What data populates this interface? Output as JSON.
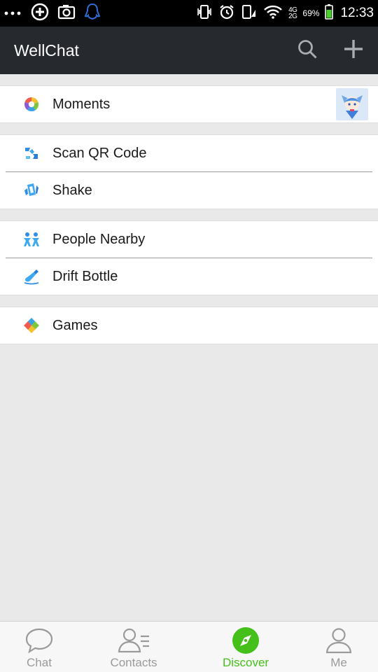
{
  "status_bar": {
    "network": "4G\n2G",
    "battery_percent": "69%",
    "time": "12:33"
  },
  "header": {
    "title": "WellChat"
  },
  "groups": [
    {
      "items": [
        {
          "label": "Moments",
          "icon": "moments-icon"
        }
      ]
    },
    {
      "items": [
        {
          "label": "Scan QR Code",
          "icon": "scan-qr-icon"
        },
        {
          "label": "Shake",
          "icon": "shake-icon"
        }
      ]
    },
    {
      "items": [
        {
          "label": "People Nearby",
          "icon": "people-nearby-icon"
        },
        {
          "label": "Drift Bottle",
          "icon": "drift-bottle-icon"
        }
      ]
    },
    {
      "items": [
        {
          "label": "Games",
          "icon": "games-icon"
        }
      ]
    }
  ],
  "tabs": [
    {
      "label": "Chat",
      "icon": "chat-icon",
      "active": false
    },
    {
      "label": "Contacts",
      "icon": "contacts-icon",
      "active": false
    },
    {
      "label": "Discover",
      "icon": "compass-icon",
      "active": true
    },
    {
      "label": "Me",
      "icon": "person-icon",
      "active": false
    }
  ],
  "colors": {
    "header_bg": "#262a2f",
    "accent_green": "#45c01a",
    "page_bg": "#e9e9e9",
    "tab_inactive": "#9a9a9a"
  }
}
